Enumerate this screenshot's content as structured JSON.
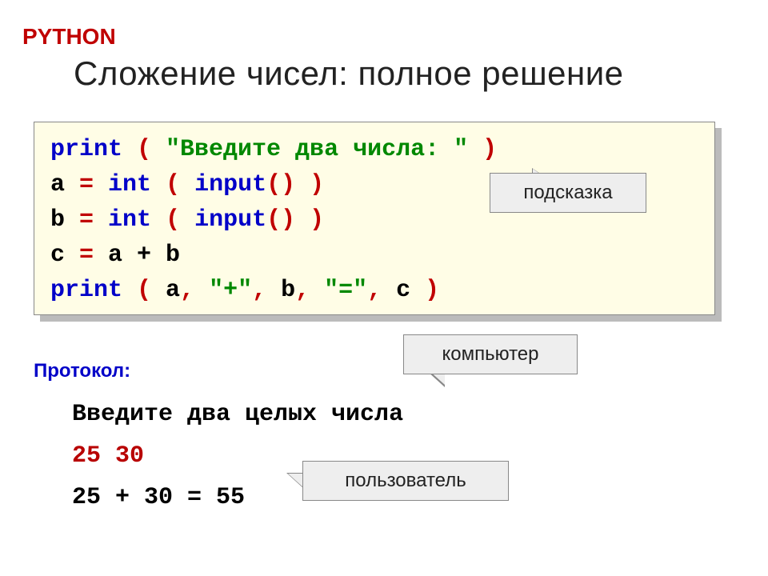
{
  "header": {
    "label": "PYTHON",
    "title": "Сложение чисел: полное решение"
  },
  "code": {
    "line1": {
      "print": "print",
      "lp": " ( ",
      "str": "\"Введите два числа: \"",
      "rp": " )"
    },
    "line2": {
      "a": "a",
      "eq": " = ",
      "int": "int",
      "lp": " ( ",
      "input": "input",
      "call": "()",
      "rp": " )"
    },
    "line3": {
      "b": "b",
      "eq": " = ",
      "int": "int",
      "lp": " ( ",
      "input": "input",
      "call": "()",
      "rp": " )"
    },
    "line4": {
      "c": "c",
      "eq": " = ",
      "expr": "a + b"
    },
    "line5": {
      "print": "print",
      "lp": " ( ",
      "a": "a",
      "c1": ", ",
      "s1": "\"+\"",
      "c2": ", ",
      "b": "b",
      "c3": ", ",
      "s2": "\"=\"",
      "c4": ", ",
      "cc": "c",
      "rp": " )"
    }
  },
  "callouts": {
    "hint": "подсказка",
    "computer": "компьютер",
    "user": "пользователь"
  },
  "protocol": {
    "label": "Протокол:",
    "prompt": "Введите два целых числа",
    "input": "25 30",
    "result": "25 + 30 = 55"
  }
}
